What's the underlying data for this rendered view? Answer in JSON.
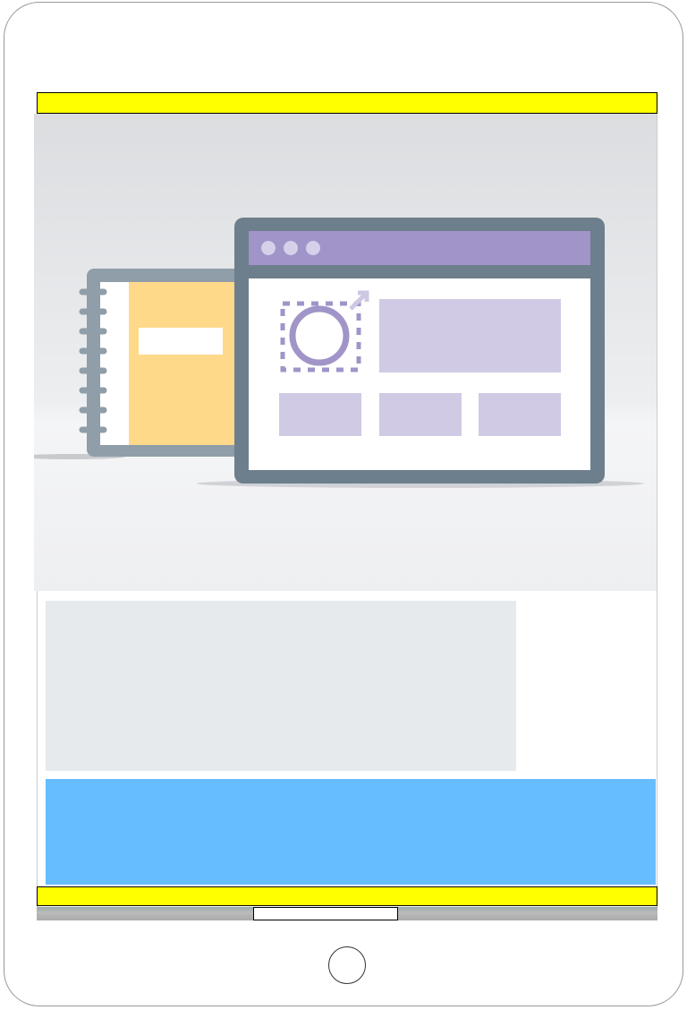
{
  "colors": {
    "top_bar": "#ffff00",
    "content_block": "#e7eaed",
    "banner": "#66bdff",
    "window_title_bar": "#a094c8",
    "notebook_cover": "#ffd98a"
  },
  "icons": {
    "hero": "web-editor-illustration",
    "home": "home-button"
  }
}
